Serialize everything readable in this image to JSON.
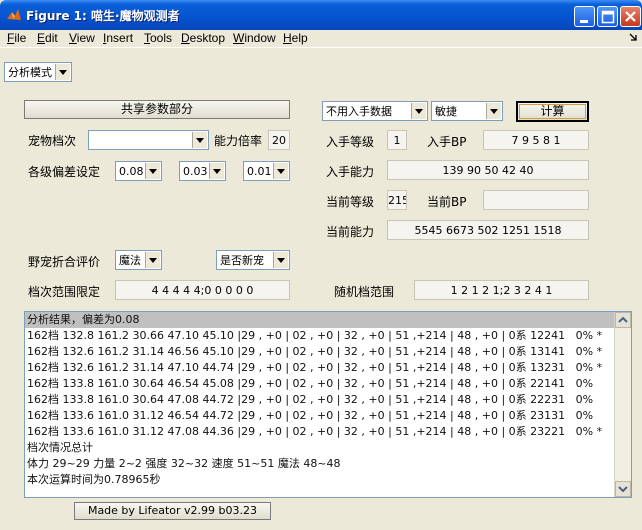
{
  "window": {
    "title": "Figure 1: 喵生·魔物观测者"
  },
  "menu": [
    {
      "label": "File",
      "u": "F",
      "rest": "ile"
    },
    {
      "label": "Edit",
      "u": "E",
      "rest": "dit"
    },
    {
      "label": "View",
      "u": "V",
      "rest": "iew"
    },
    {
      "label": "Insert",
      "u": "I",
      "rest": "nsert"
    },
    {
      "label": "Tools",
      "u": "T",
      "rest": "ools"
    },
    {
      "label": "Desktop",
      "u": "D",
      "rest": "esktop"
    },
    {
      "label": "Window",
      "u": "W",
      "rest": "indow"
    },
    {
      "label": "Help",
      "u": "H",
      "rest": "elp"
    }
  ],
  "mode_select": "分析模式",
  "shared": {
    "button": "共享参数部分",
    "pet_tier_label": "宠物档次",
    "pet_tier_value": "",
    "ratio_label": "能力倍率",
    "ratio_value": "20",
    "deviation_label": "各级偏差设定",
    "dev1": "0.08",
    "dev2": "0.03",
    "dev3": "0.01",
    "wild_label": "野宠折合评价",
    "wild_value": "魔法",
    "new_pet_value": "是否新宠",
    "tier_limit_label": "档次范围限定",
    "tier_limit_value": "4 4 4 4 4;0 0 0 0 0"
  },
  "right": {
    "source_select": "不用入手数据",
    "order_select": "敏捷",
    "calc_button": "计算",
    "acq_level_label": "入手等级",
    "acq_level_value": "1",
    "acq_bp_label": "入手BP",
    "acq_bp_value": "7 9 5 8 1",
    "acq_ability_label": "入手能力",
    "acq_ability_value": "139 90 50 42 40",
    "cur_level_label": "当前等级",
    "cur_level_value": "215",
    "cur_bp_label": "当前BP",
    "cur_bp_value": "",
    "cur_ability_label": "当前能力",
    "cur_ability_value": "5545 6673 502 1251 1518",
    "random_tier_label": "随机档范围",
    "random_tier_value": "1 2 1 2 1;2 3 2 4 1"
  },
  "results": [
    "分析结果，偏差为0.08",
    "162档 132.8 161.2 30.66 47.10 45.10 |29 , +0 | 02 , +0 | 32 , +0 | 51 ,+214 | 48 , +0 | 0系 12241   0% *",
    "162档 132.6 161.2 31.14 46.56 45.10 |29 , +0 | 02 , +0 | 32 , +0 | 51 ,+214 | 48 , +0 | 0系 13141   0% *",
    "162档 132.6 161.2 31.14 47.10 44.74 |29 , +0 | 02 , +0 | 32 , +0 | 51 ,+214 | 48 , +0 | 0系 13231   0% *",
    "162档 133.8 161.0 30.64 46.54 45.08 |29 , +0 | 02 , +0 | 32 , +0 | 51 ,+214 | 48 , +0 | 0系 22141   0%",
    "162档 133.8 161.0 30.64 47.08 44.72 |29 , +0 | 02 , +0 | 32 , +0 | 51 ,+214 | 48 , +0 | 0系 22231   0%",
    "162档 133.6 161.0 31.12 46.54 44.72 |29 , +0 | 02 , +0 | 32 , +0 | 51 ,+214 | 48 , +0 | 0系 23131   0%",
    "162档 133.6 161.0 31.12 47.08 44.36 |29 , +0 | 02 , +0 | 32 , +0 | 51 ,+214 | 48 , +0 | 0系 23221   0% *",
    "档次情况总计",
    "体力 29~29 力量 2~2 强度 32~32 速度 51~51 魔法 48~48",
    "本次运算时间为0.78965秒"
  ],
  "footer": "Made by Lifeator   v2.99 b03.23"
}
